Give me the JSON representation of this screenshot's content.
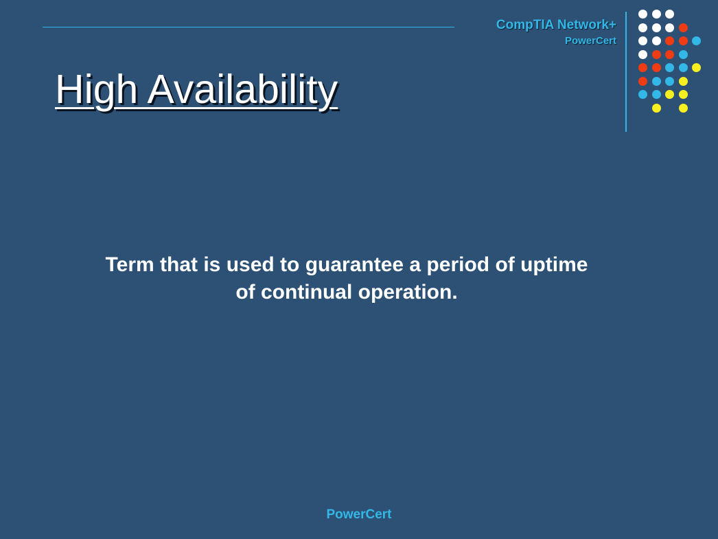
{
  "header": {
    "brand_title": "CompTIA Network+",
    "brand_subtitle": "PowerCert"
  },
  "slide": {
    "title": "High Availability",
    "body_lines": [
      "Term that is used to guarantee a period of uptime",
      "of continual operation."
    ]
  },
  "footer": {
    "text": "PowerCert"
  },
  "decor": {
    "dot_colors": {
      "white": "#ffffff",
      "red": "#f03c14",
      "blue": "#33b7e6",
      "yellow": "#f6f021"
    },
    "dot_rows": [
      [
        "white",
        "white",
        "white",
        null,
        null
      ],
      [
        "white",
        "white",
        "white",
        "red",
        null
      ],
      [
        "white",
        "white",
        "red",
        "red",
        "blue"
      ],
      [
        "white",
        "red",
        "red",
        "blue",
        null
      ],
      [
        "red",
        "red",
        "blue",
        "blue",
        "yellow"
      ],
      [
        "red",
        "blue",
        "blue",
        "yellow",
        null
      ],
      [
        "blue",
        "blue",
        "yellow",
        "yellow",
        null
      ],
      [
        null,
        "yellow",
        null,
        "yellow",
        null
      ]
    ]
  }
}
